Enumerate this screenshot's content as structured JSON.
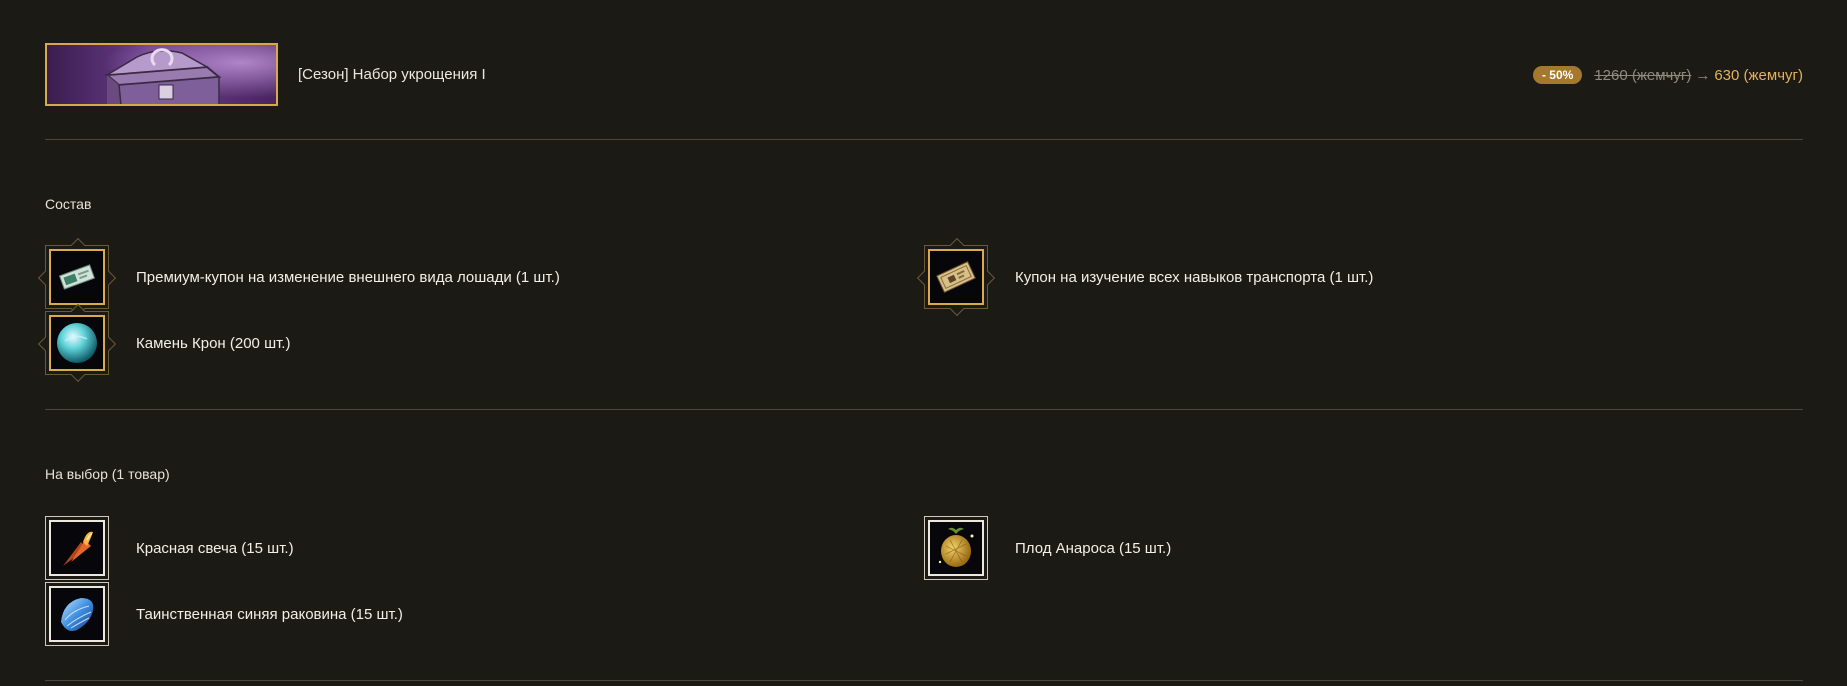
{
  "header": {
    "title": "[Сезон] Набор укрощения I",
    "discount_badge": "- 50%",
    "old_price": "1260 (жемчуг)",
    "arrow": "→",
    "new_price": "630 (жемчуг)"
  },
  "composition": {
    "title": "Состав",
    "items": [
      {
        "label": "Премиум-купон на изменение внешнего вида лошади (1 шт.)",
        "icon": "horse-coupon-icon"
      },
      {
        "label": "Купон на изучение всех навыков транспорта (1 шт.)",
        "icon": "transport-coupon-icon"
      },
      {
        "label": "Камень Крон (200 шт.)",
        "icon": "cron-stone-icon"
      }
    ]
  },
  "choice": {
    "title": "На выбор (1 товар)",
    "items": [
      {
        "label": "Красная свеча (15 шт.)",
        "icon": "red-candle-icon"
      },
      {
        "label": "Плод Анароса (15 шт.)",
        "icon": "anaros-fruit-icon"
      },
      {
        "label": "Таинственная синяя раковина (15 шт.)",
        "icon": "blue-shell-icon"
      }
    ]
  },
  "colors": {
    "background": "#1c1a14",
    "gold_accent": "#d7a94a",
    "price_new": "#e4b15a",
    "badge": "#a5782c"
  }
}
